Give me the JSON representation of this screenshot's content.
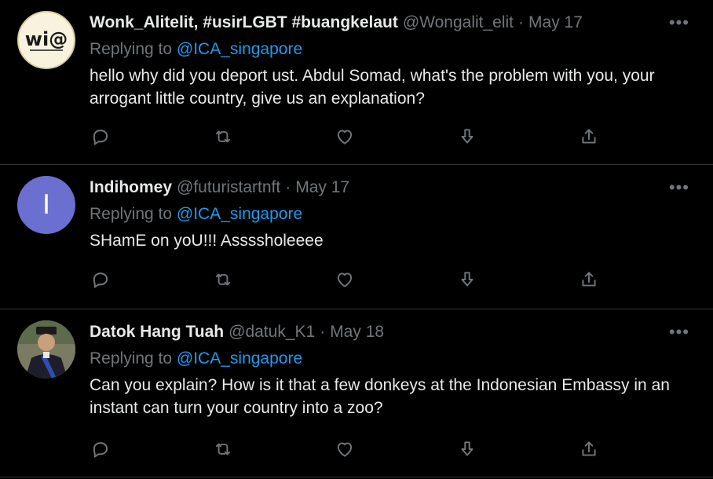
{
  "tweets": [
    {
      "name": "Wonk_Alitelit, #usirLGBT #buangkelaut",
      "handle": "@Wongalit_elit",
      "date": "May 17",
      "replying_prefix": "Replying to",
      "replying_to": "@ICA_singapore",
      "text": "hello why did you deport ust.  Abdul Somad, what's the problem with you, your arrogant little country, give us an explanation?",
      "avatar_text": "wi@"
    },
    {
      "name": "Indihomey",
      "handle": "@futuristartnft",
      "date": "May 17",
      "replying_prefix": "Replying to",
      "replying_to": "@ICA_singapore",
      "text": "SHamE on yoU!!! Assssholeeee",
      "avatar_text": "I"
    },
    {
      "name": "Datok Hang Tuah",
      "handle": "@datuk_K1",
      "date": "May 18",
      "replying_prefix": "Replying to",
      "replying_to": "@ICA_singapore",
      "text": "Can you explain? How is it that a few donkeys at the Indonesian Embassy in an instant can turn your country into a zoo?"
    }
  ],
  "separator": "·",
  "more_label": "•••",
  "icons": [
    "reply-icon",
    "retweet-icon",
    "like-icon",
    "downvote-icon",
    "share-icon"
  ],
  "colors": {
    "background": "#000000",
    "text": "#e7e9ea",
    "muted": "#71767b",
    "link": "#1d9bf0",
    "divider": "#2f3336"
  }
}
